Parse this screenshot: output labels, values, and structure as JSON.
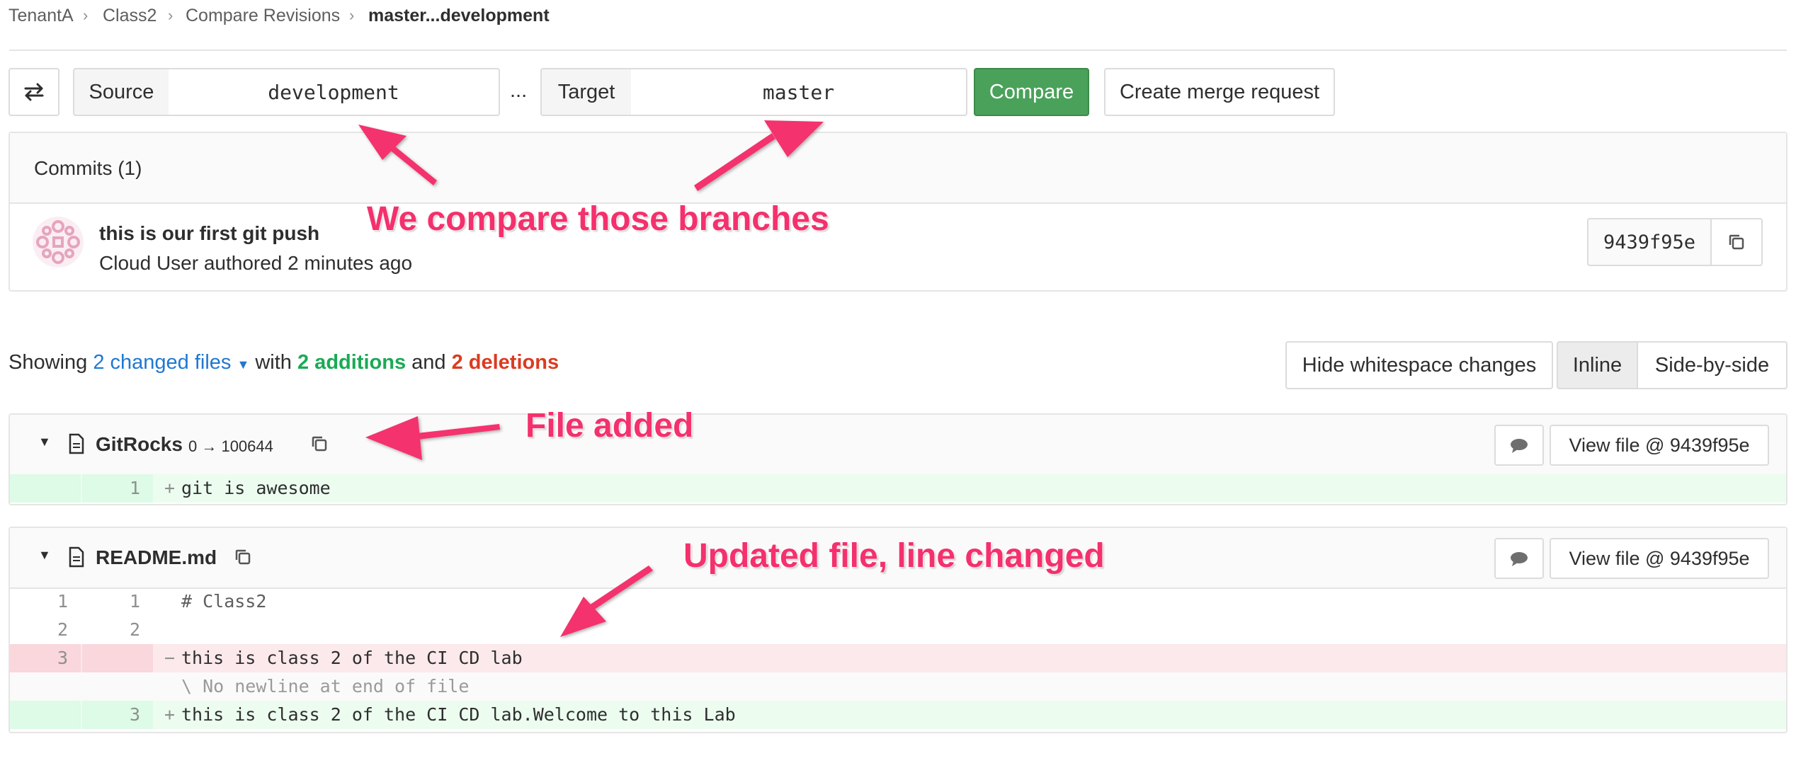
{
  "breadcrumb": {
    "items": [
      "TenantA",
      "Class2",
      "Compare Revisions"
    ],
    "current": "master...development"
  },
  "compare_bar": {
    "swap_icon": "swap-arrows-icon",
    "source_label": "Source",
    "source_value": "development",
    "separator": "...",
    "target_label": "Target",
    "target_value": "master",
    "compare_label": "Compare",
    "merge_request_label": "Create merge request"
  },
  "commits": {
    "title": "Commits (1)",
    "items": [
      {
        "message": "this is our first git push",
        "author_line": "Cloud User authored 2 minutes ago",
        "sha": "9439f95e",
        "avatar_icon": "identicon-avatar",
        "copy_icon": "copy-icon"
      }
    ]
  },
  "summary": {
    "prefix": "Showing",
    "changed_files": "2 changed files",
    "with": "with",
    "additions": "2 additions",
    "and": "and",
    "deletions": "2 deletions"
  },
  "view_controls": {
    "hide_whitespace": "Hide whitespace changes",
    "inline": "Inline",
    "side_by_side": "Side-by-side"
  },
  "files": [
    {
      "name": "GitRocks",
      "mode_change": "0 → 100644",
      "view_file_label": "View file @ 9439f95e",
      "lines": [
        {
          "old": "",
          "new": "1",
          "sign": "+",
          "type": "add",
          "text": "git is awesome"
        }
      ]
    },
    {
      "name": "README.md",
      "mode_change": "",
      "view_file_label": "View file @ 9439f95e",
      "lines": [
        {
          "old": "1",
          "new": "1",
          "sign": "",
          "type": "context",
          "text": "# Class2"
        },
        {
          "old": "2",
          "new": "2",
          "sign": "",
          "type": "context",
          "text": ""
        },
        {
          "old": "3",
          "new": "",
          "sign": "−",
          "type": "del",
          "text": "this is class 2 of the CI CD lab"
        },
        {
          "old": "",
          "new": "",
          "sign": "",
          "type": "match",
          "text": "\\ No newline at end of file"
        },
        {
          "old": "",
          "new": "3",
          "sign": "+",
          "type": "add",
          "text": "this is class 2 of the CI CD lab.Welcome to this Lab"
        }
      ]
    }
  ],
  "annotations": {
    "branches": "We compare those branches",
    "file_added": "File added",
    "updated_file": "Updated file, line changed"
  },
  "colors": {
    "green_button": "#4aa15a",
    "link_blue": "#1f78d1",
    "addition_green": "#1aaa55",
    "deletion_red": "#db3b21",
    "annotation_pink": "#f4306d"
  }
}
